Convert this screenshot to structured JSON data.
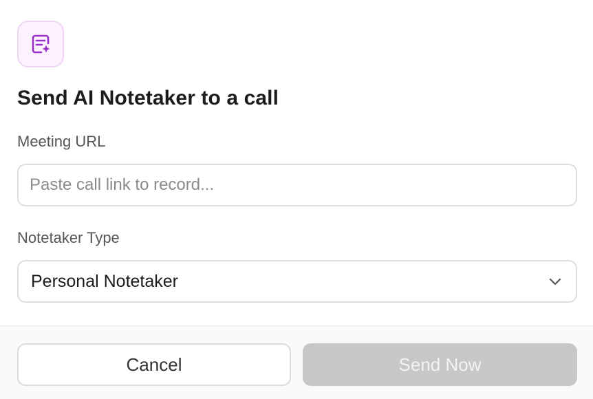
{
  "dialog": {
    "icon": "note-sparkle-icon",
    "accent_color": "#9b2fc9",
    "title": "Send AI Notetaker to a call"
  },
  "form": {
    "meeting_url": {
      "label": "Meeting URL",
      "value": "",
      "placeholder": "Paste call link to record..."
    },
    "notetaker_type": {
      "label": "Notetaker Type",
      "selected": "Personal Notetaker",
      "icon": "chevron-down-icon"
    }
  },
  "footer": {
    "cancel_label": "Cancel",
    "send_label": "Send Now",
    "send_disabled": true
  }
}
